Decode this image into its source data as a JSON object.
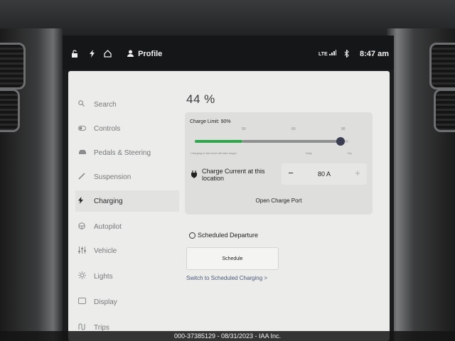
{
  "status_bar": {
    "profile_label": "Profile",
    "network": "LTE",
    "time": "8:47 am"
  },
  "sidebar": {
    "items": [
      {
        "label": "Search",
        "icon": "search-icon"
      },
      {
        "label": "Controls",
        "icon": "toggle-icon"
      },
      {
        "label": "Pedals & Steering",
        "icon": "car-icon"
      },
      {
        "label": "Suspension",
        "icon": "suspension-icon"
      },
      {
        "label": "Charging",
        "icon": "lightning-icon",
        "active": true
      },
      {
        "label": "Autopilot",
        "icon": "steering-wheel-icon"
      },
      {
        "label": "Vehicle",
        "icon": "sliders-icon"
      },
      {
        "label": "Lights",
        "icon": "sun-icon"
      },
      {
        "label": "Display",
        "icon": "display-icon"
      },
      {
        "label": "Trips",
        "icon": "trips-icon"
      }
    ]
  },
  "charging": {
    "battery_percent": "44 %",
    "charge_limit_label": "Charge Limit: 90%",
    "charge_limit_value": 90,
    "battery_level": 44,
    "slider_ticks": [
      "50",
      "60",
      "90"
    ],
    "slider_note": "Charging to this level will take longer",
    "slider_daily": "Daily",
    "slider_trip": "Trip",
    "charge_current_label": "Charge Current at this location",
    "charge_current_value": "80 A",
    "minus": "−",
    "plus": "+",
    "open_port_label": "Open Charge Port",
    "scheduled_departure_label": "Scheduled Departure",
    "schedule_button": "Schedule",
    "switch_link": "Switch to Scheduled Charging >"
  },
  "watermark": "000-37385129 - 08/31/2023 - IAA Inc.",
  "colors": {
    "accent_green": "#2ca84a",
    "knob": "#3b3d50"
  }
}
